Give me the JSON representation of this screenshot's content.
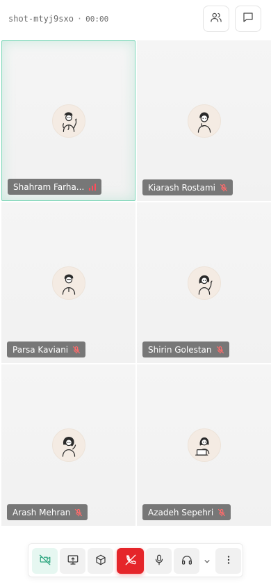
{
  "header": {
    "session_id": "shot-mtyj9sxo",
    "separator": "·",
    "timer": "00:00",
    "participants_button_icon": "people-icon",
    "chat_button_icon": "chat-icon"
  },
  "participants": [
    {
      "name": "Shahram Farha...",
      "active_speaker": true,
      "status_icon": "audio-level-icon"
    },
    {
      "name": "Kiarash Rostami",
      "active_speaker": false,
      "status_icon": "mic-muted-icon"
    },
    {
      "name": "Parsa Kaviani",
      "active_speaker": false,
      "status_icon": "mic-muted-icon"
    },
    {
      "name": "Shirin Golestan",
      "active_speaker": false,
      "status_icon": "mic-muted-icon"
    },
    {
      "name": "Arash Mehran",
      "active_speaker": false,
      "status_icon": "mic-muted-icon"
    },
    {
      "name": "Azadeh Sepehri",
      "active_speaker": false,
      "status_icon": "mic-muted-icon"
    }
  ],
  "controls": [
    {
      "name": "camera-off-button",
      "icon": "camera-off-icon"
    },
    {
      "name": "screen-share-button",
      "icon": "screen-share-icon"
    },
    {
      "name": "apps-button",
      "icon": "cube-icon"
    },
    {
      "name": "leave-call-button",
      "icon": "phone-off-icon"
    },
    {
      "name": "microphone-button",
      "icon": "mic-icon"
    },
    {
      "name": "audio-output-button",
      "icon": "headphones-icon"
    },
    {
      "name": "audio-options-dropdown",
      "icon": "chevron-down-icon"
    },
    {
      "name": "more-options-button",
      "icon": "more-vertical-icon"
    }
  ],
  "colors": {
    "accent": "#7dd6b8",
    "danger": "#e5252a",
    "muted_icon": "#ff6b6b",
    "speaking_bars": "#ff4d5a",
    "tile_background": "#f3f3f3",
    "nametag_background": "#5c5c5c"
  }
}
